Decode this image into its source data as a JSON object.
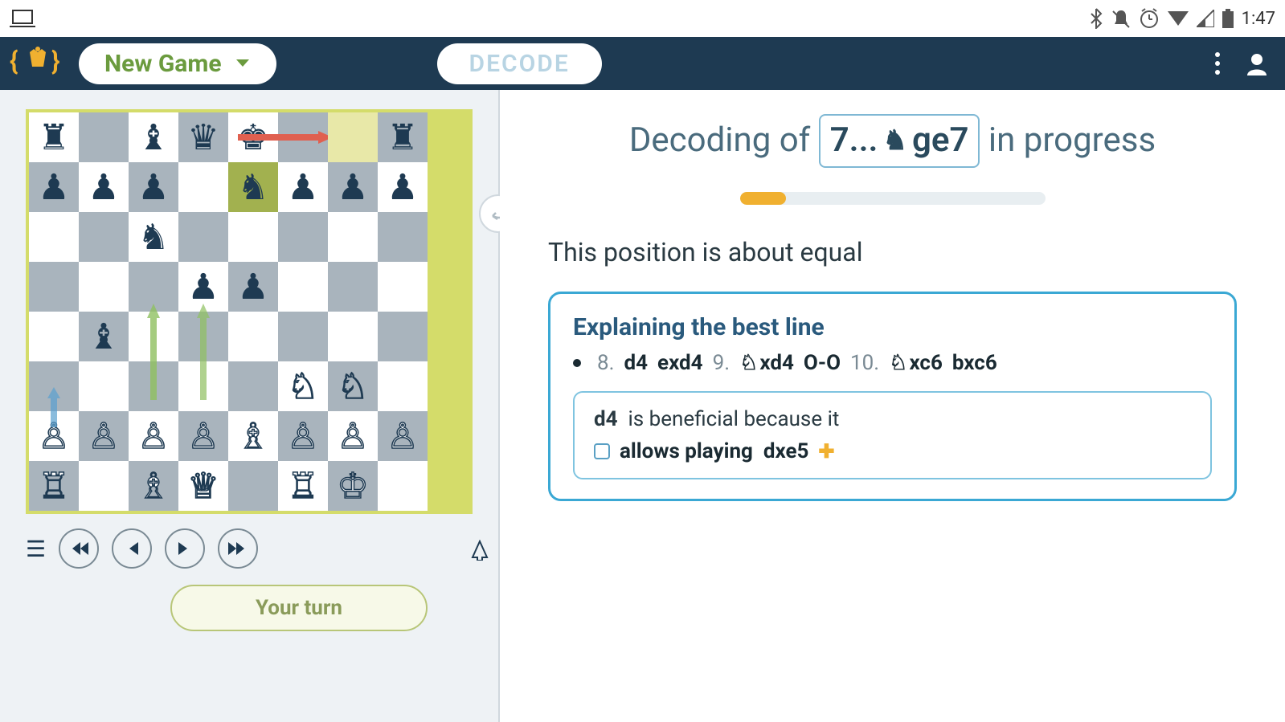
{
  "status_bar": {
    "time": "1:47"
  },
  "header": {
    "new_game_label": "New Game",
    "decode_label": "DECODE"
  },
  "board": {
    "squares": [
      [
        "r",
        "",
        "b",
        "q",
        "k",
        "",
        "",
        "r"
      ],
      [
        "p",
        "p",
        "p",
        "",
        "n",
        "p",
        "p",
        "p"
      ],
      [
        "",
        "",
        "n",
        "",
        "",
        "",
        "",
        ""
      ],
      [
        "",
        "",
        "",
        "p",
        "p",
        "",
        "",
        ""
      ],
      [
        "",
        "b",
        "",
        "",
        "",
        "",
        "",
        ""
      ],
      [
        "",
        "",
        "",
        "",
        "",
        "N",
        "N",
        ""
      ],
      [
        "P",
        "P",
        "P",
        "P",
        "B",
        "P",
        "P",
        "P"
      ],
      [
        "R",
        "",
        "B",
        "Q",
        "",
        "R",
        "K",
        ""
      ]
    ],
    "highlight": {
      "row": 1,
      "col": 4
    },
    "highlight2": {
      "row": 0,
      "col": 6
    }
  },
  "controls": {
    "turn_label": "Your turn"
  },
  "right": {
    "decode_prefix": "Decoding of",
    "decode_move_num": "7...",
    "decode_move": "ge7",
    "decode_suffix": "in progress",
    "progress_pct": 15,
    "eval_text": "This position is about equal",
    "best_line": {
      "title": "Explaining the best line",
      "moves": [
        {
          "num": "8.",
          "m1": "d4",
          "m2": "exd4"
        },
        {
          "num": "9.",
          "m1": "xd4",
          "p1": "N",
          "m2": "O-O"
        },
        {
          "num": "10.",
          "m1": "xc6",
          "p1": "N",
          "m2": "bxc6"
        }
      ]
    },
    "explain": {
      "move": "d4",
      "text": "is beneficial because it",
      "reason": "allows playing",
      "reason_move": "dxe5"
    }
  }
}
